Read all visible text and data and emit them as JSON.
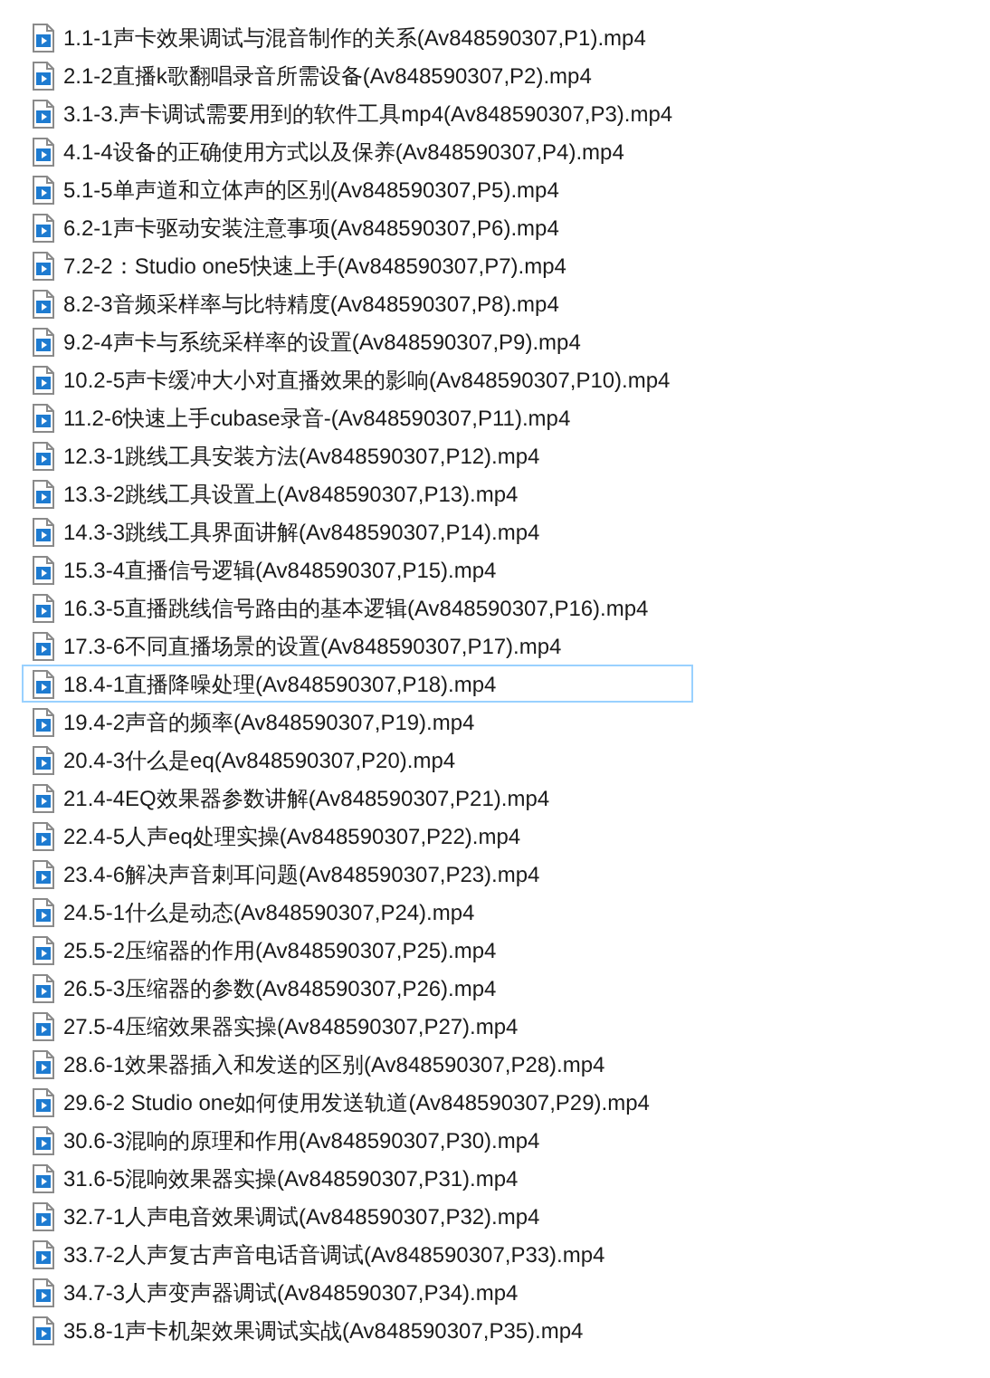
{
  "files": [
    {
      "name": "1.1-1声卡效果调试与混音制作的关系(Av848590307,P1).mp4",
      "focused": false
    },
    {
      "name": "2.1-2直播k歌翻唱录音所需设备(Av848590307,P2).mp4",
      "focused": false
    },
    {
      "name": "3.1-3.声卡调试需要用到的软件工具mp4(Av848590307,P3).mp4",
      "focused": false
    },
    {
      "name": "4.1-4设备的正确使用方式以及保养(Av848590307,P4).mp4",
      "focused": false
    },
    {
      "name": "5.1-5单声道和立体声的区别(Av848590307,P5).mp4",
      "focused": false
    },
    {
      "name": "6.2-1声卡驱动安装注意事项(Av848590307,P6).mp4",
      "focused": false
    },
    {
      "name": "7.2-2：Studio one5快速上手(Av848590307,P7).mp4",
      "focused": false
    },
    {
      "name": "8.2-3音频采样率与比特精度(Av848590307,P8).mp4",
      "focused": false
    },
    {
      "name": "9.2-4声卡与系统采样率的设置(Av848590307,P9).mp4",
      "focused": false
    },
    {
      "name": "10.2-5声卡缓冲大小对直播效果的影响(Av848590307,P10).mp4",
      "focused": false
    },
    {
      "name": "11.2-6快速上手cubase录音-(Av848590307,P11).mp4",
      "focused": false
    },
    {
      "name": "12.3-1跳线工具安装方法(Av848590307,P12).mp4",
      "focused": false
    },
    {
      "name": "13.3-2跳线工具设置上(Av848590307,P13).mp4",
      "focused": false
    },
    {
      "name": "14.3-3跳线工具界面讲解(Av848590307,P14).mp4",
      "focused": false
    },
    {
      "name": "15.3-4直播信号逻辑(Av848590307,P15).mp4",
      "focused": false
    },
    {
      "name": "16.3-5直播跳线信号路由的基本逻辑(Av848590307,P16).mp4",
      "focused": false
    },
    {
      "name": "17.3-6不同直播场景的设置(Av848590307,P17).mp4",
      "focused": false
    },
    {
      "name": "18.4-1直播降噪处理(Av848590307,P18).mp4",
      "focused": true
    },
    {
      "name": "19.4-2声音的频率(Av848590307,P19).mp4",
      "focused": false
    },
    {
      "name": "20.4-3什么是eq(Av848590307,P20).mp4",
      "focused": false
    },
    {
      "name": "21.4-4EQ效果器参数讲解(Av848590307,P21).mp4",
      "focused": false
    },
    {
      "name": "22.4-5人声eq处理实操(Av848590307,P22).mp4",
      "focused": false
    },
    {
      "name": "23.4-6解决声音刺耳问题(Av848590307,P23).mp4",
      "focused": false
    },
    {
      "name": "24.5-1什么是动态(Av848590307,P24).mp4",
      "focused": false
    },
    {
      "name": "25.5-2压缩器的作用(Av848590307,P25).mp4",
      "focused": false
    },
    {
      "name": "26.5-3压缩器的参数(Av848590307,P26).mp4",
      "focused": false
    },
    {
      "name": "27.5-4压缩效果器实操(Av848590307,P27).mp4",
      "focused": false
    },
    {
      "name": "28.6-1效果器插入和发送的区别(Av848590307,P28).mp4",
      "focused": false
    },
    {
      "name": "29.6-2 Studio one如何使用发送轨道(Av848590307,P29).mp4",
      "focused": false
    },
    {
      "name": "30.6-3混响的原理和作用(Av848590307,P30).mp4",
      "focused": false
    },
    {
      "name": "31.6-5混响效果器实操(Av848590307,P31).mp4",
      "focused": false
    },
    {
      "name": "32.7-1人声电音效果调试(Av848590307,P32).mp4",
      "focused": false
    },
    {
      "name": "33.7-2人声复古声音电话音调试(Av848590307,P33).mp4",
      "focused": false
    },
    {
      "name": "34.7-3人声变声器调试(Av848590307,P34).mp4",
      "focused": false
    },
    {
      "name": "35.8-1声卡机架效果调试实战(Av848590307,P35).mp4",
      "focused": false
    }
  ]
}
